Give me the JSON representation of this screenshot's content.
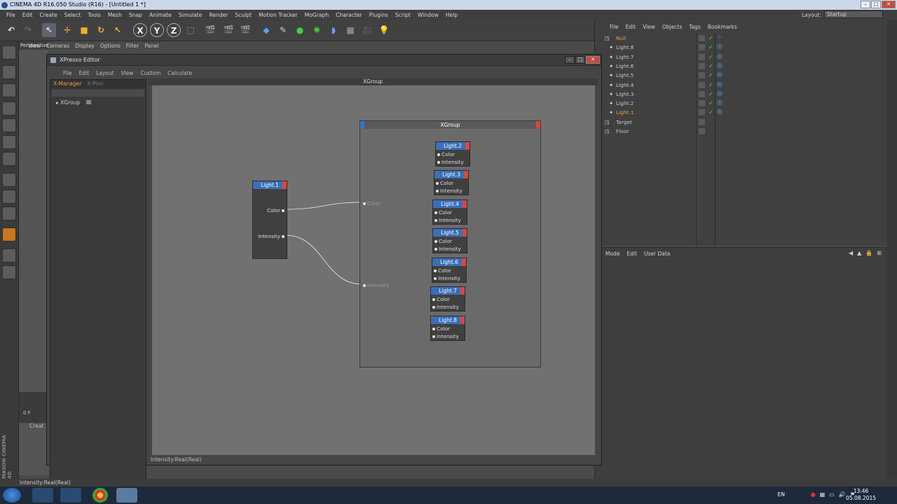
{
  "window_title": "CINEMA 4D R16.050 Studio (R16) - [Untitled 1 *]",
  "main_menu": [
    "File",
    "Edit",
    "Create",
    "Select",
    "Tools",
    "Mesh",
    "Snap",
    "Animate",
    "Simulate",
    "Render",
    "Sculpt",
    "Motion Tracker",
    "MoGraph",
    "Character",
    "Plugins",
    "Script",
    "Window",
    "Help"
  ],
  "layout": {
    "label": "Layout:",
    "value": "Startup"
  },
  "viewport": {
    "menu": [
      "View",
      "Cameras",
      "Display",
      "Options",
      "Filter",
      "Panel"
    ],
    "label": "Perspective",
    "frame": "0 F",
    "create_label": "Creat"
  },
  "xpresso": {
    "title": "XPresso Editor",
    "menu": [
      "File",
      "Edit",
      "Layout",
      "View",
      "Custom",
      "Calculate"
    ],
    "tabs": [
      "X-Manager",
      "X-Pool"
    ],
    "tree_item": "XGroup",
    "canvas_title": "XGroup",
    "status": "Intensity:Real(Real)",
    "source_node": {
      "title": "Light.1",
      "ports": [
        "Color",
        "Intensity"
      ]
    },
    "group_node": {
      "title": "XGroup",
      "ports": [
        "Color",
        "Intensity"
      ]
    },
    "target_nodes": [
      {
        "title": "Light.2",
        "ports": [
          "Color",
          "Intensity"
        ]
      },
      {
        "title": "Light.3",
        "ports": [
          "Color",
          "Intensity"
        ]
      },
      {
        "title": "Light.4",
        "ports": [
          "Color",
          "Intensity"
        ]
      },
      {
        "title": "Light.5",
        "ports": [
          "Color",
          "Intensity"
        ]
      },
      {
        "title": "Light.6",
        "ports": [
          "Color",
          "Intensity"
        ]
      },
      {
        "title": "Light.7",
        "ports": [
          "Color",
          "Intensity"
        ]
      },
      {
        "title": "Light.8",
        "ports": [
          "Color",
          "Intensity"
        ]
      }
    ]
  },
  "object_manager": {
    "menu": [
      "File",
      "Edit",
      "View",
      "Objects",
      "Tags",
      "Bookmarks"
    ],
    "objects": [
      {
        "name": "Null",
        "color": "#e8a040"
      },
      {
        "name": "Light.8",
        "color": "#c8c8c8"
      },
      {
        "name": "Light.7",
        "color": "#c8c8c8"
      },
      {
        "name": "Light.6",
        "color": "#c8c8c8"
      },
      {
        "name": "Light.5",
        "color": "#c8c8c8"
      },
      {
        "name": "Light.4",
        "color": "#c8c8c8"
      },
      {
        "name": "Light.3",
        "color": "#c8c8c8"
      },
      {
        "name": "Light.2",
        "color": "#c8c8c8"
      },
      {
        "name": "Light.1",
        "color": "#e8a040"
      },
      {
        "name": "Target",
        "color": "#c8c8c8"
      },
      {
        "name": "Floor",
        "color": "#c8c8c8"
      }
    ]
  },
  "attributes": {
    "menu": [
      "Mode",
      "Edit",
      "User Data"
    ]
  },
  "status_bar": "Intensity:Real(Real)",
  "taskbar": {
    "lang": "EN",
    "time": "13:46",
    "date": "05.08.2015"
  },
  "colors": {
    "accent": "#e8a040",
    "node_blue": "#3a74c4",
    "node_red": "#d44a3f",
    "canvas": "#717171"
  }
}
